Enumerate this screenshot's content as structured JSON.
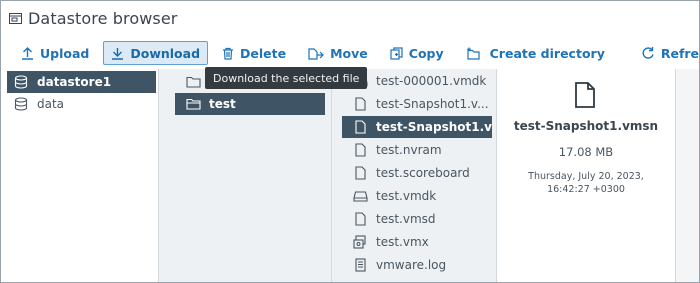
{
  "window": {
    "title": "Datastore browser",
    "icon": "datastore-browser-icon"
  },
  "toolbar": {
    "upload_label": "Upload",
    "download_label": "Download",
    "delete_label": "Delete",
    "move_label": "Move",
    "copy_label": "Copy",
    "create_directory_label": "Create directory",
    "refresh_label": "Refresh",
    "accent_color": "#1f73b7"
  },
  "tooltip": {
    "text": "Download the selected file"
  },
  "datastores": [
    {
      "label": "datastore1",
      "icon": "datastore-icon",
      "selected": true
    },
    {
      "label": "data",
      "icon": "datastore-icon",
      "selected": false
    }
  ],
  "folders": [
    {
      "label": "",
      "icon": "folder-icon",
      "selected": false
    },
    {
      "label": "test",
      "icon": "folder-icon",
      "selected": true
    }
  ],
  "files": [
    {
      "label": "test-000001.vmdk",
      "icon": "disk-icon"
    },
    {
      "label": "test-Snapshot1.v...",
      "icon": "file-icon"
    },
    {
      "label": "test-Snapshot1.v...",
      "icon": "file-icon",
      "selected": true
    },
    {
      "label": "test.nvram",
      "icon": "file-icon"
    },
    {
      "label": "test.scoreboard",
      "icon": "file-icon"
    },
    {
      "label": "test.vmdk",
      "icon": "disk-icon"
    },
    {
      "label": "test.vmsd",
      "icon": "file-icon"
    },
    {
      "label": "test.vmx",
      "icon": "vm-config-icon"
    },
    {
      "label": "vmware.log",
      "icon": "log-icon"
    }
  ],
  "details": {
    "name": "test-Snapshot1.vmsn",
    "size": "17.08 MB",
    "modified": "Thursday, July 20, 2023, 16:42:27 +0300",
    "icon": "file-icon"
  },
  "colors": {
    "selection": "#3f5566",
    "column_bg": "#eef1f3",
    "tooltip_bg": "#333b41"
  }
}
